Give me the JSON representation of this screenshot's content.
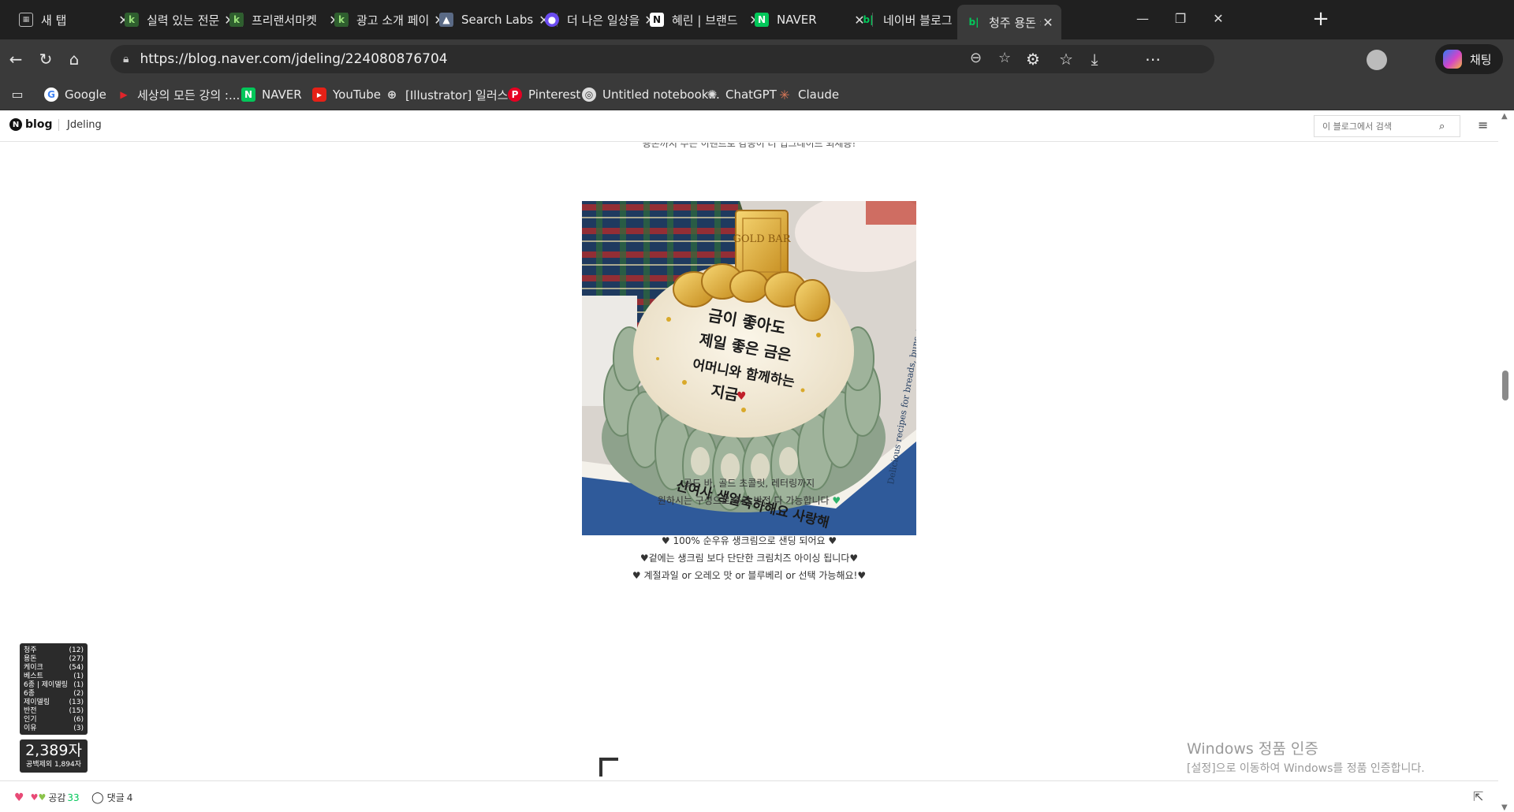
{
  "tabs": [
    {
      "label": "새 탭",
      "icon": "new-tab-icon"
    },
    {
      "label": "실력 있는 전문",
      "icon": "kmong-icon"
    },
    {
      "label": "프리랜서마켓",
      "icon": "kmong-icon"
    },
    {
      "label": "광고 소개 페이",
      "icon": "kmong-icon"
    },
    {
      "label": "Search Labs",
      "icon": "search-labs-icon"
    },
    {
      "label": "더 나은 일상을",
      "icon": "app-icon"
    },
    {
      "label": "혜린 | 브랜드",
      "icon": "notion-icon"
    },
    {
      "label": "NAVER",
      "icon": "naver-icon"
    },
    {
      "label": "네이버 블로그",
      "icon": "naver-blog-icon"
    },
    {
      "label": "청주 용돈 케이",
      "icon": "naver-blog-icon"
    }
  ],
  "address": {
    "url": "https://blog.naver.com/jdeling/224080876704"
  },
  "copilot_label": "채팅",
  "bookmarks": [
    {
      "label": "Google"
    },
    {
      "label": "세상의 모든 강의 :..."
    },
    {
      "label": "NAVER"
    },
    {
      "label": "YouTube"
    },
    {
      "label": "[Illustrator] 일러스..."
    },
    {
      "label": "Pinterest"
    },
    {
      "label": "Untitled notebook..."
    },
    {
      "label": "ChatGPT"
    },
    {
      "label": "Claude"
    }
  ],
  "blog": {
    "logo_text": "blog",
    "blog_name": "Jdeling",
    "search_placeholder": "이 블로그에서 검색"
  },
  "post": {
    "cut_text": "용돈까지 주는 이벤트로 감동이 더 업그레이드 되세용!",
    "cake_text": [
      "금이 좋아도",
      "제일 좋은 금은",
      "어머니와 함께하는",
      "지금"
    ],
    "cake_bottom_text": "신여사 생일축하해요 사랑해",
    "gold_bar_text": "GOLD BAR",
    "book_text": "Delicious recipes for breads, buns, pastries and other baked delights",
    "para1": [
      "골드 바, 골드 초콜릿, 레터링까지",
      "원하시는 구성으로 추가 반전 다 가능합니다"
    ],
    "para2": [
      "100% 순우유 생크림으로 샌딩 되어요",
      "겉에는 생크림 보다 단단한 크림치즈 아이싱 됩니다",
      "계절과일 or 오레오 맛 or 블루베리 or 선택 가능해요!"
    ]
  },
  "tags": [
    {
      "name": "청주",
      "count": "(12)"
    },
    {
      "name": "용돈",
      "count": "(27)"
    },
    {
      "name": "케이크",
      "count": "(54)"
    },
    {
      "name": "베스트",
      "count": "(1)"
    },
    {
      "name": "6종 | 제이델링",
      "count": "(1)"
    },
    {
      "name": "6종",
      "count": "(2)"
    },
    {
      "name": "제이델링",
      "count": "(13)"
    },
    {
      "name": "반전",
      "count": "(15)"
    },
    {
      "name": "인기",
      "count": "(6)"
    },
    {
      "name": "이유",
      "count": "(3)"
    }
  ],
  "char_count": {
    "total": "2,389자",
    "no_space": "공백제외 1,894자"
  },
  "watermark": {
    "line1": "Windows 정품 인증",
    "line2": "[설정]으로 이동하여 Windows를 정품 인증합니다."
  },
  "footer": {
    "like_label": "공감",
    "like_count": "33",
    "comment_label": "댓글",
    "comment_count": "4"
  },
  "colors": {
    "naver_green": "#03c75a",
    "chrome_dark": "#202020",
    "chrome_mid": "#3a3a3a"
  }
}
